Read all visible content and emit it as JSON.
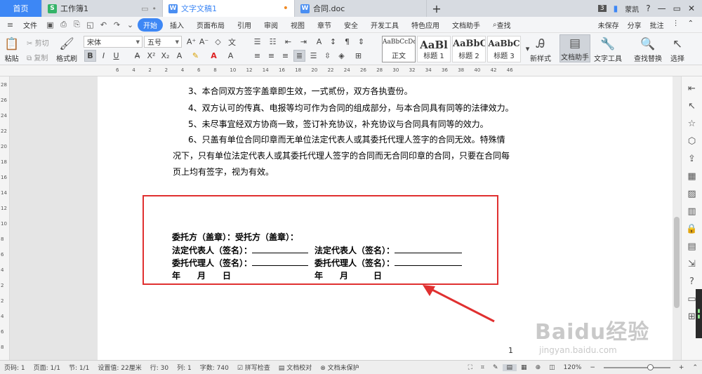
{
  "tabs": {
    "home": "首页",
    "items": [
      {
        "label": "工作簿1",
        "icon": "spreadsheet-icon",
        "color": "#34b368"
      },
      {
        "label": "文字文稿1",
        "icon": "writer-icon",
        "color": "#4a8ef2"
      },
      {
        "label": "合同.doc",
        "icon": "writer-icon",
        "color": "#4a8ef2"
      }
    ],
    "plus": "+",
    "user": "蒙凯",
    "badge": "3"
  },
  "menu": {
    "file": "文件",
    "items": [
      "开始",
      "插入",
      "页面布局",
      "引用",
      "审阅",
      "视图",
      "章节",
      "安全",
      "开发工具",
      "特色应用",
      "文档助手"
    ],
    "search": "查找",
    "right": [
      "未保存",
      "分享",
      "批注"
    ]
  },
  "ribbon": {
    "paste": "粘贴",
    "cut": "剪切",
    "copy": "复制",
    "format_painter": "格式刷",
    "font_name": "宋体",
    "font_size": "五号",
    "styles": [
      {
        "preview": "AaBbCcDd",
        "name": "正文"
      },
      {
        "preview": "AaBl",
        "name": "标题 1"
      },
      {
        "preview": "AaBbC",
        "name": "标题 2"
      },
      {
        "preview": "AaBbC",
        "name": "标题 3"
      }
    ],
    "new_style": "新样式",
    "doc_assistant": "文档助手",
    "text_tools": "文字工具",
    "find_replace": "查找替换",
    "select": "选择"
  },
  "ruler": {
    "hmarks": [
      "6",
      "4",
      "2",
      "2",
      "4",
      "6",
      "8",
      "10",
      "12",
      "14",
      "16",
      "18",
      "20",
      "22",
      "24",
      "26",
      "28",
      "30",
      "32",
      "34",
      "36",
      "38",
      "40",
      "42",
      "46"
    ],
    "vmarks": [
      "28",
      "26",
      "24",
      "22",
      "20",
      "18",
      "16",
      "14",
      "12",
      "10",
      "8",
      "6",
      "4",
      "2",
      "2",
      "4",
      "6",
      "8"
    ]
  },
  "doc": {
    "lines": [
      "3、本合同双方签字盖章即生效，一式贰份，双方各执壹份。",
      "4、双方认可的传真、电报等均可作为合同的组成部分，与本合同具有同等的法律效力。",
      "5、未尽事宜经双方协商一致，签订补充协议，补充协议与合同具有同等的效力。",
      "6、只盖有单位合同印章而无单位法定代表人或其委托代理人签字的合同无效。特殊情",
      "况下，只有单位法定代表人或其委托代理人签字的合同而无合同印章的合同，只要在合同每",
      "页上均有签字，视为有效。"
    ],
    "sig": {
      "parties": "委托方（盖章）：受托方（盖章）：",
      "rep_left": "法定代表人（签名）：",
      "rep_right": "法定代表人（签名）：",
      "agent_left": "委托代理人（签名）：",
      "agent_right": "委托代理人（签名）：",
      "date_left": "年　　月　　日",
      "date_right": "年　　月　　　日"
    },
    "page_number": "1"
  },
  "watermark": {
    "brand": "Baidu经验",
    "url": "jingyan.baidu.com"
  },
  "status": {
    "page_code": "页码: 1",
    "pages": "页面: 1/1",
    "section": "节: 1/1",
    "setting": "设置值: 22厘米",
    "row": "行: 30",
    "col": "列: 1",
    "words": "字数: 740",
    "spell": "拼写检查",
    "proofread": "文档校对",
    "protect": "文档未保护",
    "zoom": "120%"
  },
  "colors": {
    "accent": "#3d87f5",
    "highlight_box": "#e03030"
  }
}
